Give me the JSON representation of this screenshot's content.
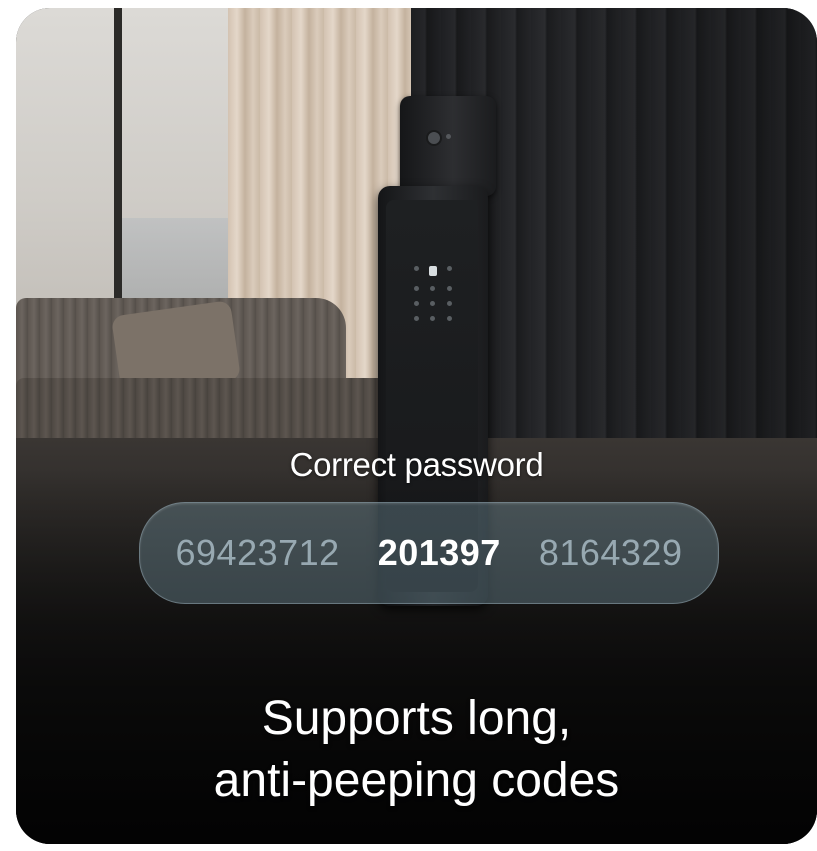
{
  "overlay": {
    "status_label": "Correct password",
    "codes": [
      {
        "text": "69423712",
        "highlighted": false
      },
      {
        "text": "201397",
        "highlighted": true
      },
      {
        "text": "8164329",
        "highlighted": false
      }
    ]
  },
  "headline": {
    "line1": "Supports long,",
    "line2": "anti-peeping codes"
  },
  "colors": {
    "pill_tint": "#6e8a96",
    "highlight_text": "#ffffff",
    "dim_text": "#bed2dc"
  },
  "icons": {
    "keypad_lit_key": "lock-icon",
    "camera": "camera-icon"
  }
}
